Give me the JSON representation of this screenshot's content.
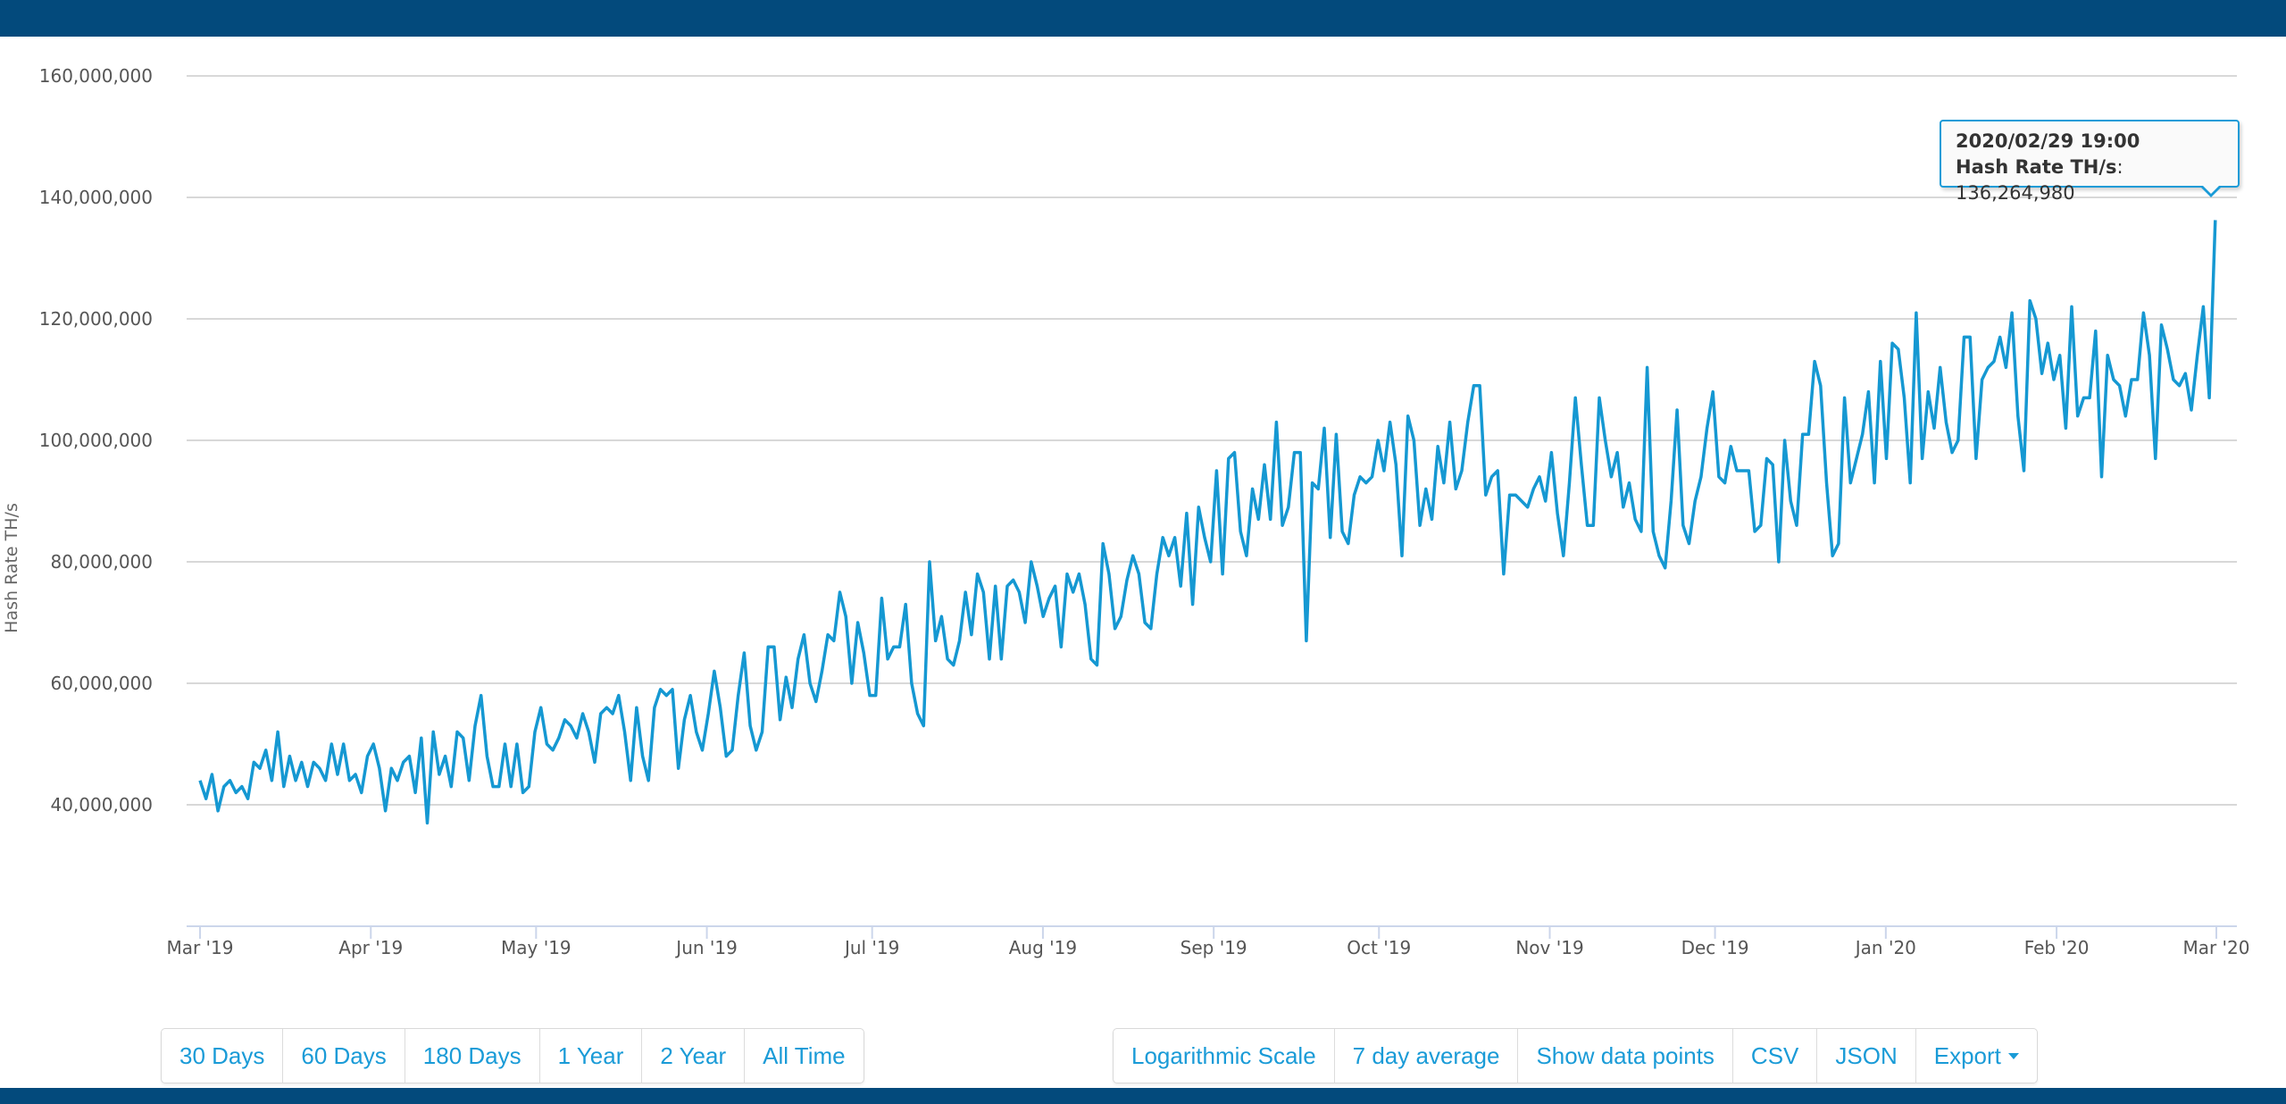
{
  "chart_data": {
    "type": "line",
    "ylabel": "Hash Rate TH/s",
    "xlabel": "",
    "ylim": [
      20000000,
      160000000
    ],
    "yticks": [
      40000000,
      60000000,
      80000000,
      100000000,
      120000000,
      140000000,
      160000000
    ],
    "ytick_labels": [
      "40,000,000",
      "60,000,000",
      "80,000,000",
      "100,000,000",
      "120,000,000",
      "140,000,000",
      "160,000,000"
    ],
    "grid": true,
    "x_start": "2019-03-01",
    "x_end": "2020-02-29T19:00",
    "x_range_days": 366,
    "xticks": [
      {
        "day": 0,
        "label": "Mar '19"
      },
      {
        "day": 31,
        "label": "Apr '19"
      },
      {
        "day": 61,
        "label": "May '19"
      },
      {
        "day": 92,
        "label": "Jun '19"
      },
      {
        "day": 122,
        "label": "Jul '19"
      },
      {
        "day": 153,
        "label": "Aug '19"
      },
      {
        "day": 184,
        "label": "Sep '19"
      },
      {
        "day": 214,
        "label": "Oct '19"
      },
      {
        "day": 245,
        "label": "Nov '19"
      },
      {
        "day": 275,
        "label": "Dec '19"
      },
      {
        "day": 306,
        "label": "Jan '20"
      },
      {
        "day": 337,
        "label": "Feb '20"
      },
      {
        "day": 366,
        "label": "Mar '20"
      }
    ],
    "series": [
      {
        "name": "Hash Rate TH/s",
        "color": "#1598d2",
        "unit_scale": 1000000,
        "values": [
          44,
          41,
          45,
          39,
          43,
          44,
          42,
          43,
          41,
          47,
          46,
          49,
          44,
          52,
          43,
          48,
          44,
          47,
          43,
          47,
          46,
          44,
          50,
          45,
          50,
          44,
          45,
          42,
          48,
          50,
          46,
          39,
          46,
          44,
          47,
          48,
          42,
          51,
          37,
          52,
          45,
          48,
          43,
          52,
          51,
          44,
          53,
          58,
          48,
          43,
          43,
          50,
          43,
          50,
          42,
          43,
          52,
          56,
          50,
          49,
          51,
          54,
          53,
          51,
          55,
          52,
          47,
          55,
          56,
          55,
          58,
          52,
          44,
          56,
          48,
          44,
          56,
          59,
          58,
          59,
          46,
          54,
          58,
          52,
          49,
          55,
          62,
          56,
          48,
          49,
          58,
          65,
          53,
          49,
          52,
          66,
          66,
          54,
          61,
          56,
          64,
          68,
          60,
          57,
          62,
          68,
          67,
          75,
          71,
          60,
          70,
          65,
          58,
          58,
          74,
          64,
          66,
          66,
          73,
          60,
          55,
          53,
          80,
          67,
          71,
          64,
          63,
          67,
          75,
          68,
          78,
          75,
          64,
          76,
          64,
          76,
          77,
          75,
          70,
          80,
          76,
          71,
          74,
          76,
          66,
          78,
          75,
          78,
          73,
          64,
          63,
          83,
          78,
          69,
          71,
          77,
          81,
          78,
          70,
          69,
          78,
          84,
          81,
          84,
          76,
          88,
          73,
          89,
          84,
          80,
          95,
          78,
          97,
          98,
          85,
          81,
          92,
          87,
          96,
          87,
          103,
          86,
          89,
          98,
          98,
          67,
          93,
          92,
          102,
          84,
          101,
          85,
          83,
          91,
          94,
          93,
          94,
          100,
          95,
          103,
          96,
          81,
          104,
          100,
          86,
          92,
          87,
          99,
          93,
          103,
          92,
          95,
          103,
          109,
          109,
          91,
          94,
          95,
          78,
          91,
          91,
          90,
          89,
          92,
          94,
          90,
          98,
          88,
          81,
          93,
          107,
          96,
          86,
          86,
          107,
          100,
          94,
          98,
          89,
          93,
          87,
          85,
          112,
          85,
          81,
          79,
          90,
          105,
          86,
          83,
          90,
          94,
          102,
          108,
          94,
          93,
          99,
          95,
          95,
          95,
          85,
          86,
          97,
          96,
          80,
          100,
          90,
          86,
          101,
          101,
          113,
          109,
          93,
          81,
          83,
          107,
          93,
          97,
          101,
          108,
          93,
          113,
          97,
          116,
          115,
          107,
          93,
          121,
          97,
          108,
          102,
          112,
          103,
          98,
          100,
          117,
          117,
          97,
          110,
          112,
          113,
          117,
          112,
          121,
          104,
          95,
          123,
          120,
          111,
          116,
          110,
          114,
          102,
          122,
          104,
          107,
          107,
          118,
          94,
          114,
          110,
          109,
          104,
          110,
          110,
          121,
          114,
          97,
          119,
          115,
          110,
          109,
          111,
          105,
          114,
          122,
          107,
          136.26498
        ]
      }
    ],
    "tooltip": {
      "date": "2020/02/29 19:00",
      "series_label": "Hash Rate TH/s",
      "separator": ": ",
      "value": "136,264,980"
    }
  },
  "range_buttons": [
    "30 Days",
    "60 Days",
    "180 Days",
    "1 Year",
    "2 Year",
    "All Time"
  ],
  "option_buttons": [
    "Logarithmic Scale",
    "7 day average",
    "Show data points",
    "CSV",
    "JSON"
  ],
  "export_button": "Export",
  "colors": {
    "header": "#034a7c",
    "accent": "#1a9bd7",
    "grid": "#d8d8d8"
  }
}
